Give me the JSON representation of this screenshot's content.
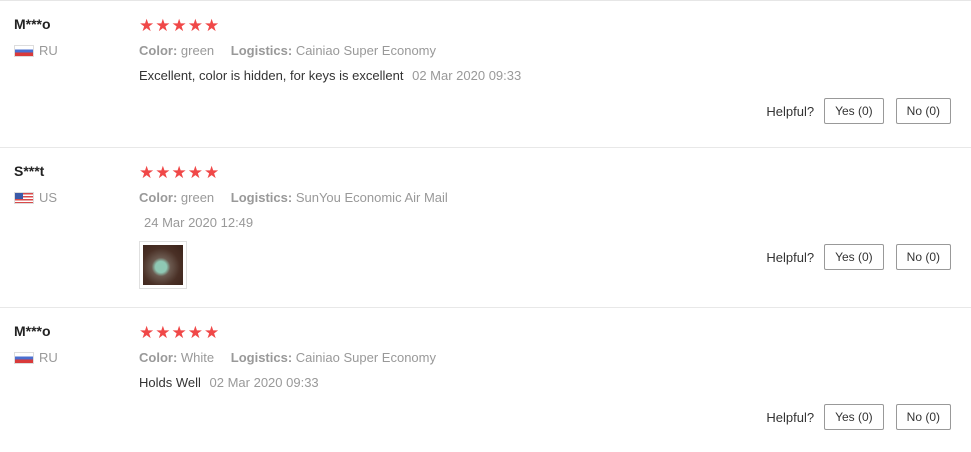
{
  "reviews": [
    {
      "user": "M***o",
      "country": "RU",
      "stars": "★★★★★",
      "color_label": "Color:",
      "color_value": "green",
      "logistics_label": "Logistics:",
      "logistics_value": "Cainiao Super Economy",
      "text": "Excellent, color is hidden, for keys is excellent",
      "date": "02 Mar 2020 09:33",
      "helpful_label": "Helpful?",
      "yes_label": "Yes (0)",
      "no_label": "No (0)"
    },
    {
      "user": "S***t",
      "country": "US",
      "stars": "★★★★★",
      "color_label": "Color:",
      "color_value": "green",
      "logistics_label": "Logistics:",
      "logistics_value": "SunYou Economic Air Mail",
      "text": "",
      "date": "24 Mar 2020 12:49",
      "helpful_label": "Helpful?",
      "yes_label": "Yes (0)",
      "no_label": "No (0)"
    },
    {
      "user": "M***o",
      "country": "RU",
      "stars": "★★★★★",
      "color_label": "Color:",
      "color_value": "White",
      "logistics_label": "Logistics:",
      "logistics_value": "Cainiao Super Economy",
      "text": "Holds Well",
      "date": "02 Mar 2020 09:33",
      "helpful_label": "Helpful?",
      "yes_label": "Yes (0)",
      "no_label": "No (0)"
    }
  ],
  "colors": {
    "star": "#f04848",
    "muted": "#999999",
    "text": "#333333"
  },
  "icons": {
    "flag_ru": "flag-ru-icon",
    "flag_us": "flag-us-icon",
    "star": "star-icon"
  }
}
